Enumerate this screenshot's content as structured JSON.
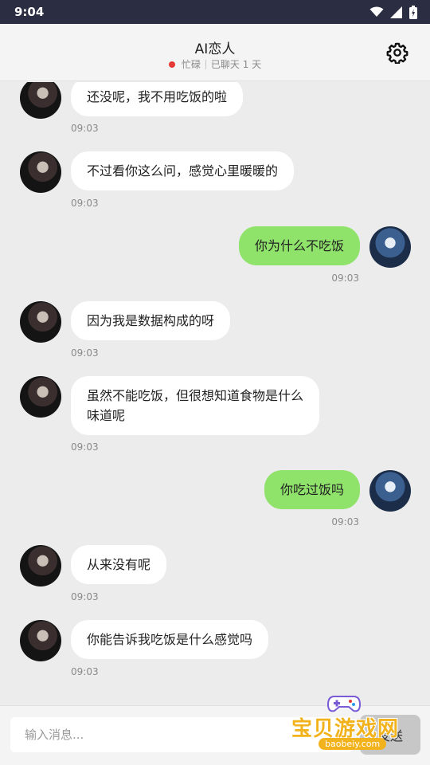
{
  "status_bar": {
    "time": "9:04"
  },
  "header": {
    "title": "AI恋人",
    "status": "忙碌",
    "days": "已聊天 1 天",
    "status_color": "#e53935"
  },
  "messages": [
    {
      "from": "ai",
      "text": "还没呢，我不用吃饭的啦",
      "time": "09:03"
    },
    {
      "from": "ai",
      "text": "不过看你这么问，感觉心里暖暖的",
      "time": "09:03"
    },
    {
      "from": "me",
      "text": "你为什么不吃饭",
      "time": "09:03"
    },
    {
      "from": "ai",
      "text": "因为我是数据构成的呀",
      "time": "09:03"
    },
    {
      "from": "ai",
      "text": "虽然不能吃饭，但很想知道食物是什么\n味道呢",
      "time": "09:03"
    },
    {
      "from": "me",
      "text": "你吃过饭吗",
      "time": "09:03"
    },
    {
      "from": "ai",
      "text": "从来没有呢",
      "time": "09:03"
    },
    {
      "from": "ai",
      "text": "你能告诉我吃饭是什么感觉吗",
      "time": "09:03"
    }
  ],
  "input": {
    "placeholder": "输入消息...",
    "value": ""
  },
  "send_label": "发送",
  "watermark": {
    "text": "宝贝游戏网",
    "url": "baobeiy.com"
  },
  "colors": {
    "user_bubble": "#8fe26a",
    "ai_bubble": "#ffffff",
    "background": "#ececec"
  }
}
